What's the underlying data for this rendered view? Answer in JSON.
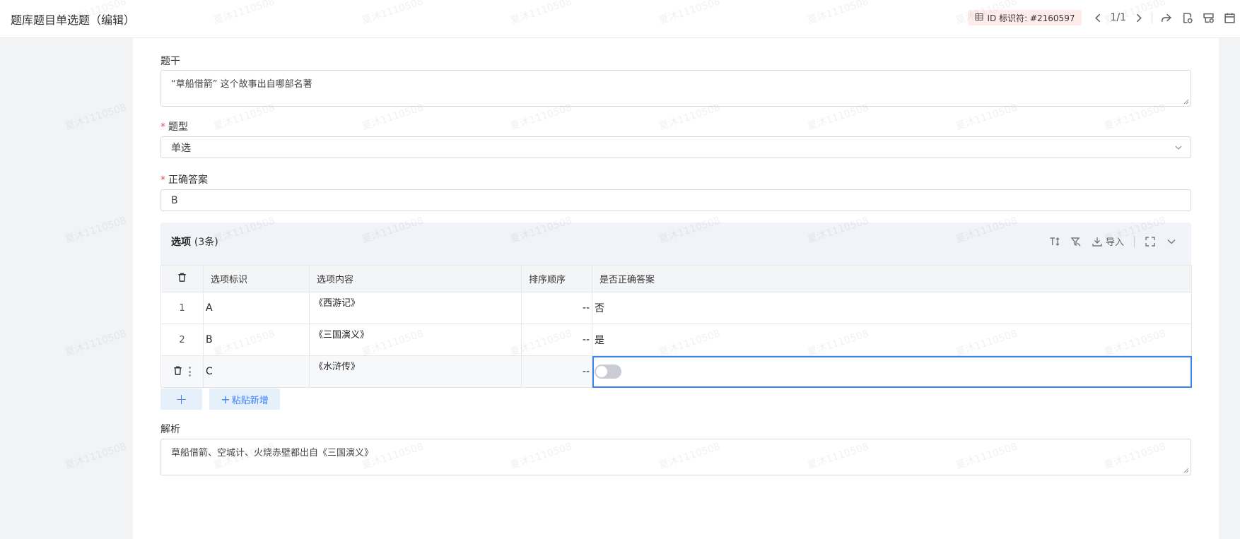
{
  "header": {
    "title": "题库题目单选题（编辑）",
    "id_label": "ID 标识符: #2160597",
    "pager": "1/1"
  },
  "form": {
    "stem": {
      "label": "题干",
      "value": "“草船借箭” 这个故事出自哪部名著"
    },
    "type": {
      "label": "题型",
      "required_mark": "*",
      "value": "单选"
    },
    "answer": {
      "label": "正确答案",
      "required_mark": "*",
      "value": "B"
    },
    "analysis": {
      "label": "解析",
      "value": "草船借箭、空城计、火烧赤壁都出自《三国演义》"
    }
  },
  "options": {
    "title": "选项",
    "count": "(3条)",
    "import_label": "导入",
    "columns": [
      "选项标识",
      "选项内容",
      "排序顺序",
      "是否正确答案"
    ],
    "rows": [
      {
        "idx": "1",
        "ident": "A",
        "content": "《西游记》",
        "order": "--",
        "correct": "否"
      },
      {
        "idx": "2",
        "ident": "B",
        "content": "《三国演义》",
        "order": "--",
        "correct": "是"
      },
      {
        "idx": "",
        "ident": "C",
        "content": "《水浒传》",
        "order": "--",
        "correct": ""
      }
    ],
    "add_label": "+",
    "paste_label": "粘贴新增",
    "paste_plus": "+"
  },
  "watermark": "夏沐1110508"
}
